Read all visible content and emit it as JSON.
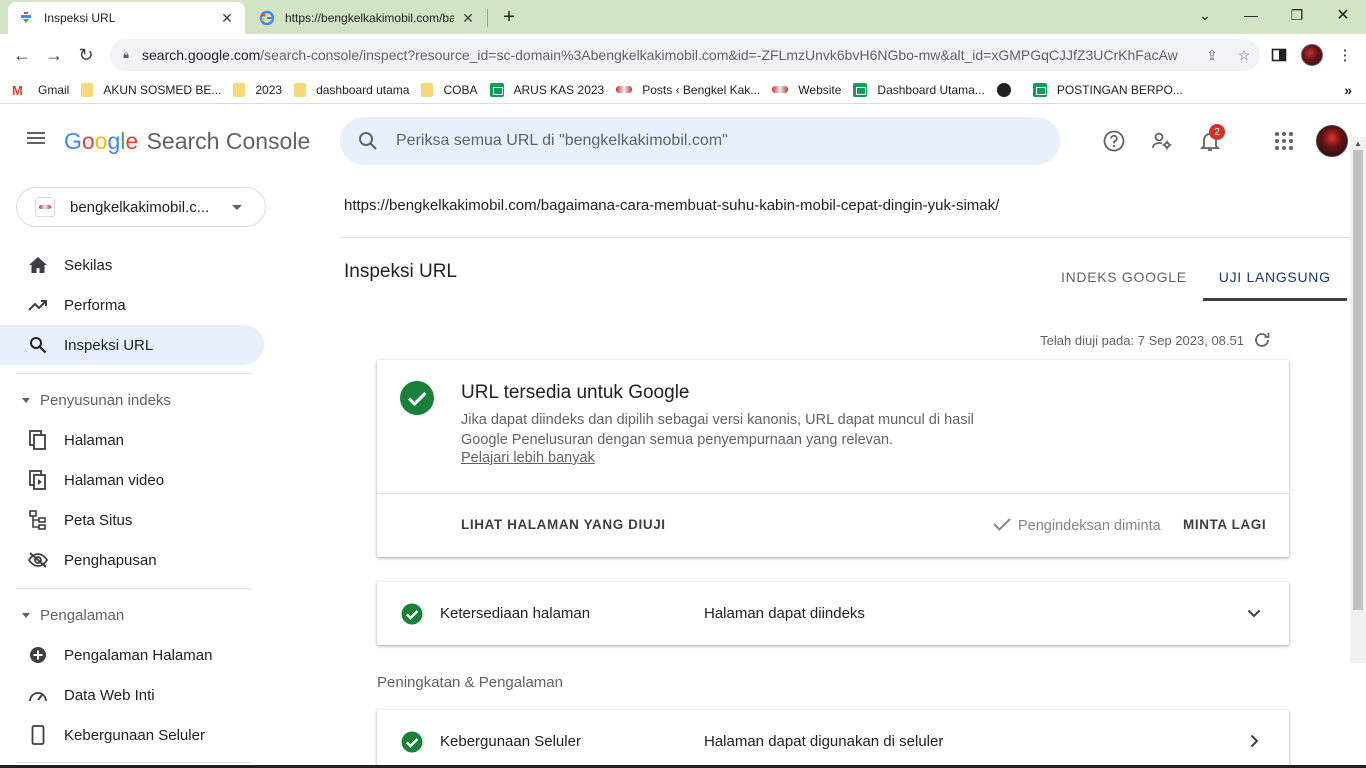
{
  "browser": {
    "tabs": [
      {
        "title": "Inspeksi URL",
        "active": true
      },
      {
        "title": "https://bengkelkakimobil.com/ba",
        "active": false
      }
    ],
    "new_tab_label": "+",
    "url_host": "search.google.com",
    "url_path": "/search-console/inspect?resource_id=sc-domain%3Abengkelkakimobil.com&id=-ZFLmzUnvk6bvH6NGbo-mw&alt_id=xGMPGqCJJfZ3UCrKhFacAw",
    "bookmarks": [
      {
        "label": "Gmail",
        "icon": "gmail-icon"
      },
      {
        "label": "AKUN SOSMED BE...",
        "icon": "folder-icon"
      },
      {
        "label": "2023",
        "icon": "folder-icon"
      },
      {
        "label": "dashboard utama",
        "icon": "folder-icon"
      },
      {
        "label": "COBA",
        "icon": "folder-icon"
      },
      {
        "label": "ARUS KAS 2023",
        "icon": "sheets-icon"
      },
      {
        "label": "Posts ‹ Bengkel Kak...",
        "icon": "site-icon"
      },
      {
        "label": "Website",
        "icon": "site-icon"
      },
      {
        "label": "Dashboard Utama...",
        "icon": "sheets-icon"
      },
      {
        "label": "",
        "icon": "globe-icon"
      },
      {
        "label": "POSTINGAN BERPO...",
        "icon": "sheets-icon"
      }
    ],
    "bookmarks_more": "»"
  },
  "app": {
    "logo_google": [
      "G",
      "o",
      "o",
      "g",
      "l",
      "e"
    ],
    "logo_product": "Search Console",
    "search_placeholder": "Periksa semua URL di \"bengkelkakimobil.com\"",
    "notification_count": "2",
    "property_name": "bengkelkakimobil.c..."
  },
  "sidebar": {
    "items_top": [
      {
        "label": "Sekilas",
        "icon": "home-icon",
        "selected": false
      },
      {
        "label": "Performa",
        "icon": "trending-up-icon",
        "selected": false
      },
      {
        "label": "Inspeksi URL",
        "icon": "search-icon",
        "selected": true
      }
    ],
    "section_index": "Penyusunan indeks",
    "items_index": [
      {
        "label": "Halaman",
        "icon": "pages-icon"
      },
      {
        "label": "Halaman video",
        "icon": "video-page-icon"
      },
      {
        "label": "Peta Situs",
        "icon": "sitemap-icon"
      },
      {
        "label": "Penghapusan",
        "icon": "visibility-off-icon"
      }
    ],
    "section_experience": "Pengalaman",
    "items_experience": [
      {
        "label": "Pengalaman Halaman",
        "icon": "add-circle-icon"
      },
      {
        "label": "Data Web Inti",
        "icon": "speed-icon"
      },
      {
        "label": "Kebergunaan Seluler",
        "icon": "smartphone-icon"
      }
    ]
  },
  "main": {
    "inspected_url": "https://bengkelkakimobil.com/bagaimana-cara-membuat-suhu-kabin-mobil-cepat-dingin-yuk-simak/",
    "title": "Inspeksi URL",
    "tabs": [
      {
        "label": "INDEKS GOOGLE",
        "active": false
      },
      {
        "label": "UJI LANGSUNG",
        "active": true
      }
    ],
    "tested_at": "Telah diuji pada: 7 Sep 2023, 08.51",
    "status_card": {
      "title": "URL tersedia untuk Google",
      "description": "Jika dapat diindeks dan dipilih sebagai versi kanonis, URL dapat muncul di hasil Google Penelusuran dengan semua penyempurnaan yang relevan.",
      "learn_more": "Pelajari lebih banyak",
      "view_tested_page": "LIHAT HALAMAN YANG DIUJI",
      "indexing_requested": "Pengindeksan diminta",
      "request_again": "MINTA LAGI"
    },
    "availability": {
      "label": "Ketersediaan halaman",
      "value": "Halaman dapat diindeks"
    },
    "section_enhancements": "Peningkatan & Pengalaman",
    "mobile_usability": {
      "label": "Kebergunaan Seluler",
      "value": "Halaman dapat digunakan di seluler"
    }
  },
  "colors": {
    "accent_blue": "#1a73e8",
    "success_green": "#188038",
    "selected_nav_bg": "#e8f0fe",
    "badge_red": "#d93025",
    "tabbar_green": "#d3e3c5"
  }
}
